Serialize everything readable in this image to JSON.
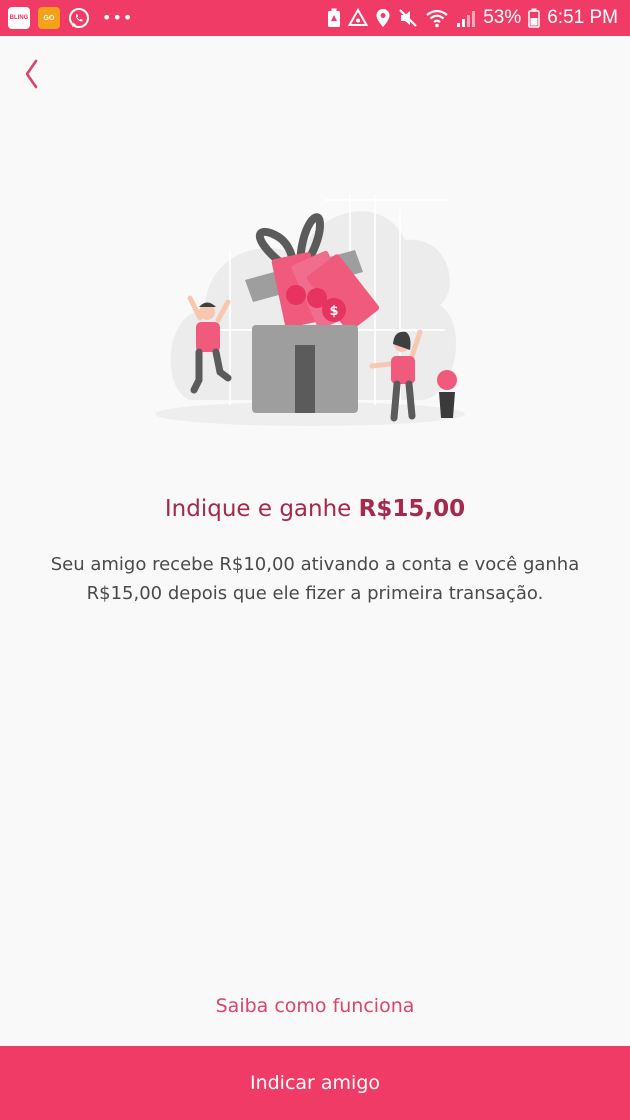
{
  "status_bar": {
    "app_badges": [
      "BLING",
      "GO"
    ],
    "overflow": "•••",
    "battery_percent": "53%",
    "time": "6:51 PM"
  },
  "colors": {
    "accent": "#ef3b66",
    "title": "#a6284b",
    "link": "#d9456b",
    "body_text": "#4a4a4a",
    "background": "#f9f9f9"
  },
  "icons": {
    "back": "chevron-left-icon",
    "whatsapp": "whatsapp-icon",
    "wifi": "wifi-icon",
    "signal": "signal-icon",
    "battery": "battery-icon",
    "location": "location-pin-icon",
    "mute": "mute-icon"
  },
  "main": {
    "title_prefix": "Indique e ganhe ",
    "title_amount": "R$15,00",
    "description": "Seu amigo recebe R$10,00 ativando a conta e você ganha R$15,00 depois que ele fizer a primeira transação.",
    "how_it_works_link": "Saiba como funciona",
    "primary_button": "Indicar amigo"
  }
}
